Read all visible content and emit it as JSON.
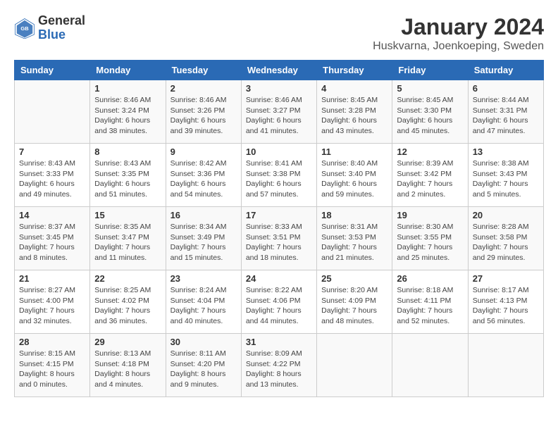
{
  "header": {
    "logo_general": "General",
    "logo_blue": "Blue",
    "title": "January 2024",
    "subtitle": "Huskvarna, Joenkoeping, Sweden"
  },
  "days_of_week": [
    "Sunday",
    "Monday",
    "Tuesday",
    "Wednesday",
    "Thursday",
    "Friday",
    "Saturday"
  ],
  "weeks": [
    [
      {
        "day": "",
        "sunrise": "",
        "sunset": "",
        "daylight": ""
      },
      {
        "day": "1",
        "sunrise": "Sunrise: 8:46 AM",
        "sunset": "Sunset: 3:24 PM",
        "daylight": "Daylight: 6 hours and 38 minutes."
      },
      {
        "day": "2",
        "sunrise": "Sunrise: 8:46 AM",
        "sunset": "Sunset: 3:26 PM",
        "daylight": "Daylight: 6 hours and 39 minutes."
      },
      {
        "day": "3",
        "sunrise": "Sunrise: 8:46 AM",
        "sunset": "Sunset: 3:27 PM",
        "daylight": "Daylight: 6 hours and 41 minutes."
      },
      {
        "day": "4",
        "sunrise": "Sunrise: 8:45 AM",
        "sunset": "Sunset: 3:28 PM",
        "daylight": "Daylight: 6 hours and 43 minutes."
      },
      {
        "day": "5",
        "sunrise": "Sunrise: 8:45 AM",
        "sunset": "Sunset: 3:30 PM",
        "daylight": "Daylight: 6 hours and 45 minutes."
      },
      {
        "day": "6",
        "sunrise": "Sunrise: 8:44 AM",
        "sunset": "Sunset: 3:31 PM",
        "daylight": "Daylight: 6 hours and 47 minutes."
      }
    ],
    [
      {
        "day": "7",
        "sunrise": "Sunrise: 8:43 AM",
        "sunset": "Sunset: 3:33 PM",
        "daylight": "Daylight: 6 hours and 49 minutes."
      },
      {
        "day": "8",
        "sunrise": "Sunrise: 8:43 AM",
        "sunset": "Sunset: 3:35 PM",
        "daylight": "Daylight: 6 hours and 51 minutes."
      },
      {
        "day": "9",
        "sunrise": "Sunrise: 8:42 AM",
        "sunset": "Sunset: 3:36 PM",
        "daylight": "Daylight: 6 hours and 54 minutes."
      },
      {
        "day": "10",
        "sunrise": "Sunrise: 8:41 AM",
        "sunset": "Sunset: 3:38 PM",
        "daylight": "Daylight: 6 hours and 57 minutes."
      },
      {
        "day": "11",
        "sunrise": "Sunrise: 8:40 AM",
        "sunset": "Sunset: 3:40 PM",
        "daylight": "Daylight: 6 hours and 59 minutes."
      },
      {
        "day": "12",
        "sunrise": "Sunrise: 8:39 AM",
        "sunset": "Sunset: 3:42 PM",
        "daylight": "Daylight: 7 hours and 2 minutes."
      },
      {
        "day": "13",
        "sunrise": "Sunrise: 8:38 AM",
        "sunset": "Sunset: 3:43 PM",
        "daylight": "Daylight: 7 hours and 5 minutes."
      }
    ],
    [
      {
        "day": "14",
        "sunrise": "Sunrise: 8:37 AM",
        "sunset": "Sunset: 3:45 PM",
        "daylight": "Daylight: 7 hours and 8 minutes."
      },
      {
        "day": "15",
        "sunrise": "Sunrise: 8:35 AM",
        "sunset": "Sunset: 3:47 PM",
        "daylight": "Daylight: 7 hours and 11 minutes."
      },
      {
        "day": "16",
        "sunrise": "Sunrise: 8:34 AM",
        "sunset": "Sunset: 3:49 PM",
        "daylight": "Daylight: 7 hours and 15 minutes."
      },
      {
        "day": "17",
        "sunrise": "Sunrise: 8:33 AM",
        "sunset": "Sunset: 3:51 PM",
        "daylight": "Daylight: 7 hours and 18 minutes."
      },
      {
        "day": "18",
        "sunrise": "Sunrise: 8:31 AM",
        "sunset": "Sunset: 3:53 PM",
        "daylight": "Daylight: 7 hours and 21 minutes."
      },
      {
        "day": "19",
        "sunrise": "Sunrise: 8:30 AM",
        "sunset": "Sunset: 3:55 PM",
        "daylight": "Daylight: 7 hours and 25 minutes."
      },
      {
        "day": "20",
        "sunrise": "Sunrise: 8:28 AM",
        "sunset": "Sunset: 3:58 PM",
        "daylight": "Daylight: 7 hours and 29 minutes."
      }
    ],
    [
      {
        "day": "21",
        "sunrise": "Sunrise: 8:27 AM",
        "sunset": "Sunset: 4:00 PM",
        "daylight": "Daylight: 7 hours and 32 minutes."
      },
      {
        "day": "22",
        "sunrise": "Sunrise: 8:25 AM",
        "sunset": "Sunset: 4:02 PM",
        "daylight": "Daylight: 7 hours and 36 minutes."
      },
      {
        "day": "23",
        "sunrise": "Sunrise: 8:24 AM",
        "sunset": "Sunset: 4:04 PM",
        "daylight": "Daylight: 7 hours and 40 minutes."
      },
      {
        "day": "24",
        "sunrise": "Sunrise: 8:22 AM",
        "sunset": "Sunset: 4:06 PM",
        "daylight": "Daylight: 7 hours and 44 minutes."
      },
      {
        "day": "25",
        "sunrise": "Sunrise: 8:20 AM",
        "sunset": "Sunset: 4:09 PM",
        "daylight": "Daylight: 7 hours and 48 minutes."
      },
      {
        "day": "26",
        "sunrise": "Sunrise: 8:18 AM",
        "sunset": "Sunset: 4:11 PM",
        "daylight": "Daylight: 7 hours and 52 minutes."
      },
      {
        "day": "27",
        "sunrise": "Sunrise: 8:17 AM",
        "sunset": "Sunset: 4:13 PM",
        "daylight": "Daylight: 7 hours and 56 minutes."
      }
    ],
    [
      {
        "day": "28",
        "sunrise": "Sunrise: 8:15 AM",
        "sunset": "Sunset: 4:15 PM",
        "daylight": "Daylight: 8 hours and 0 minutes."
      },
      {
        "day": "29",
        "sunrise": "Sunrise: 8:13 AM",
        "sunset": "Sunset: 4:18 PM",
        "daylight": "Daylight: 8 hours and 4 minutes."
      },
      {
        "day": "30",
        "sunrise": "Sunrise: 8:11 AM",
        "sunset": "Sunset: 4:20 PM",
        "daylight": "Daylight: 8 hours and 9 minutes."
      },
      {
        "day": "31",
        "sunrise": "Sunrise: 8:09 AM",
        "sunset": "Sunset: 4:22 PM",
        "daylight": "Daylight: 8 hours and 13 minutes."
      },
      {
        "day": "",
        "sunrise": "",
        "sunset": "",
        "daylight": ""
      },
      {
        "day": "",
        "sunrise": "",
        "sunset": "",
        "daylight": ""
      },
      {
        "day": "",
        "sunrise": "",
        "sunset": "",
        "daylight": ""
      }
    ]
  ]
}
